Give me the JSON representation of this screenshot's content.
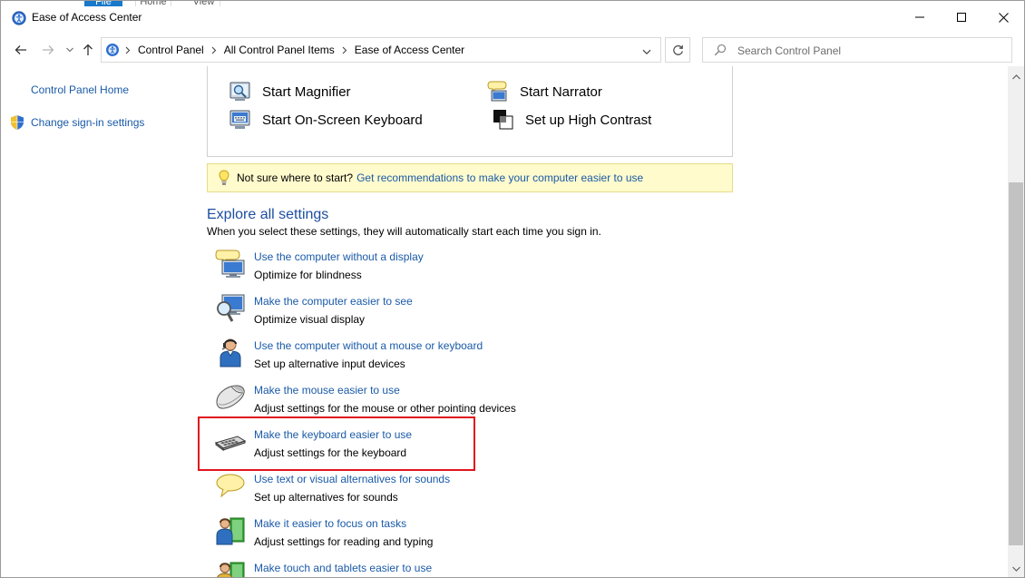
{
  "window": {
    "title": "Ease of Access Center",
    "ribbon_tabs": [
      "File",
      "Home",
      "View"
    ]
  },
  "address_bar": {
    "crumbs": [
      "Control Panel",
      "All Control Panel Items",
      "Ease of Access Center"
    ],
    "search_placeholder": "Search Control Panel"
  },
  "left_pane": {
    "links": [
      "Control Panel Home",
      "Change sign-in settings"
    ]
  },
  "quick_tools": {
    "items": [
      "Start Magnifier",
      "Start Narrator",
      "Start On-Screen Keyboard",
      "Set up High Contrast"
    ]
  },
  "tip": {
    "text": "Not sure where to start?",
    "link": "Get recommendations to make your computer easier to use"
  },
  "explore": {
    "title": "Explore all settings",
    "subtitle": "When you select these settings, they will automatically start each time you sign in.",
    "settings": [
      {
        "link": "Use the computer without a display",
        "desc": "Optimize for blindness",
        "icon": "narrator-display-icon"
      },
      {
        "link": "Make the computer easier to see",
        "desc": "Optimize visual display",
        "icon": "magnifier-monitor-icon"
      },
      {
        "link": "Use the computer without a mouse or keyboard",
        "desc": "Set up alternative input devices",
        "icon": "person-headset-icon"
      },
      {
        "link": "Make the mouse easier to use",
        "desc": "Adjust settings for the mouse or other pointing devices",
        "icon": "mouse-icon"
      },
      {
        "link": "Make the keyboard easier to use",
        "desc": "Adjust settings for the keyboard",
        "icon": "keyboard-icon"
      },
      {
        "link": "Use text or visual alternatives for sounds",
        "desc": "Set up alternatives for sounds",
        "icon": "speech-bubble-icon"
      },
      {
        "link": "Make it easier to focus on tasks",
        "desc": "Adjust settings for reading and typing",
        "icon": "person-book-icon"
      },
      {
        "link": "Make touch and tablets easier to use",
        "desc": "",
        "icon": "person-tablet-icon"
      }
    ]
  },
  "colors": {
    "link": "#1a5aa8",
    "heading": "#1c4fa0",
    "tip_background": "#fffbcc",
    "highlight_border": "#e0141e"
  }
}
